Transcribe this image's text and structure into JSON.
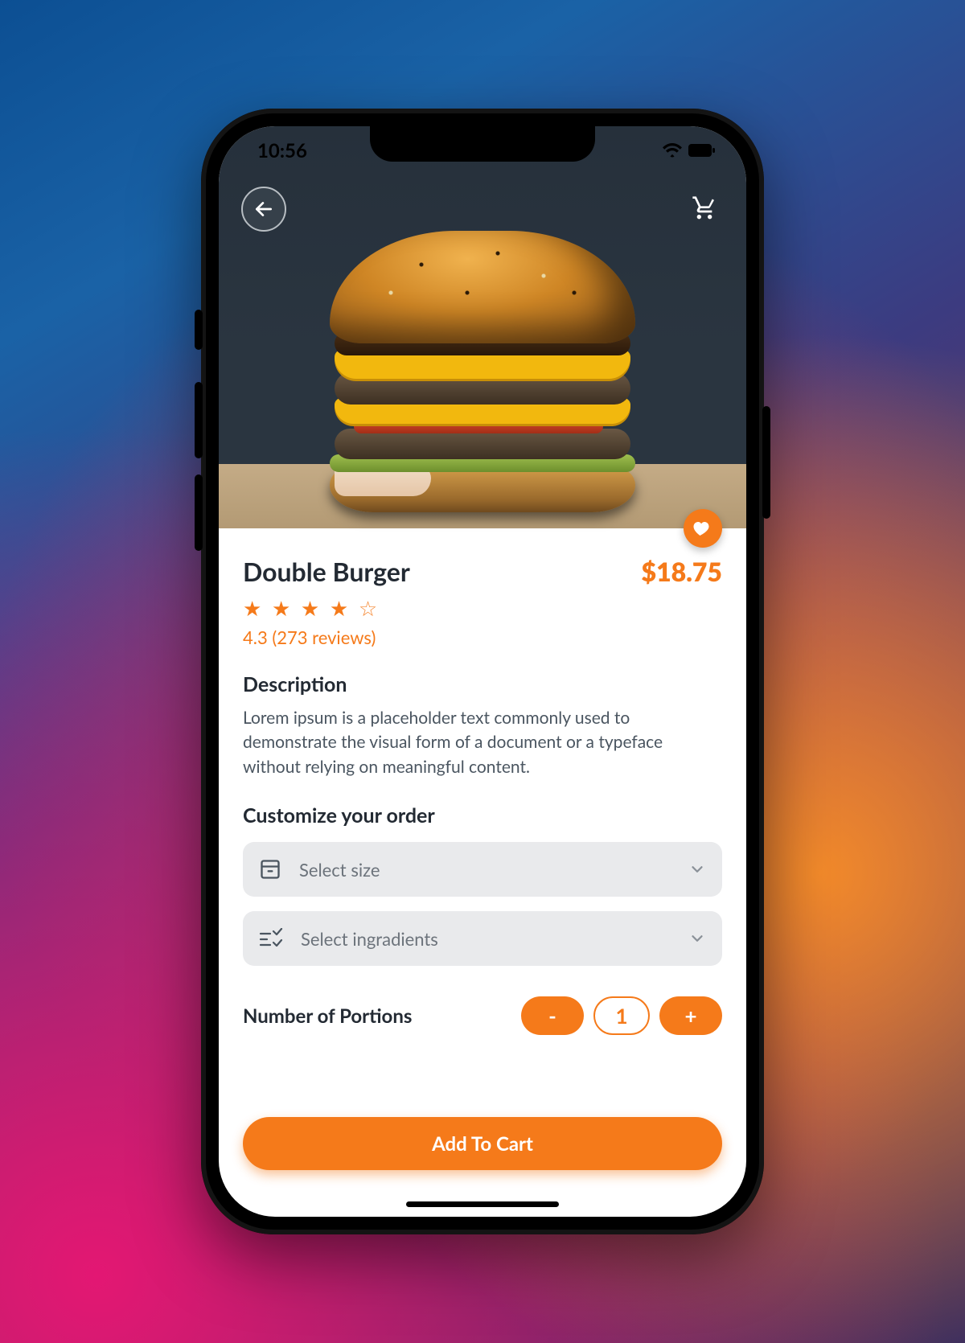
{
  "status": {
    "time": "10:56"
  },
  "product": {
    "title": "Double Burger",
    "price": "$18.75",
    "stars_filled": 4,
    "stars_total": 5,
    "rating": "4.3",
    "reviews": "273 reviews",
    "description_heading": "Description",
    "description": "Lorem ipsum is a placeholder text commonly used to demonstrate the visual form of a document or a typeface without relying on meaningful content."
  },
  "customize": {
    "heading": "Customize your order",
    "size_placeholder": "Select size",
    "ingredients_placeholder": "Select ingradients"
  },
  "portions": {
    "label": "Number of Portions",
    "minus": "-",
    "value": "1",
    "plus": "+"
  },
  "cta": {
    "add_to_cart": "Add To Cart"
  },
  "colors": {
    "accent": "#f57a1a"
  }
}
